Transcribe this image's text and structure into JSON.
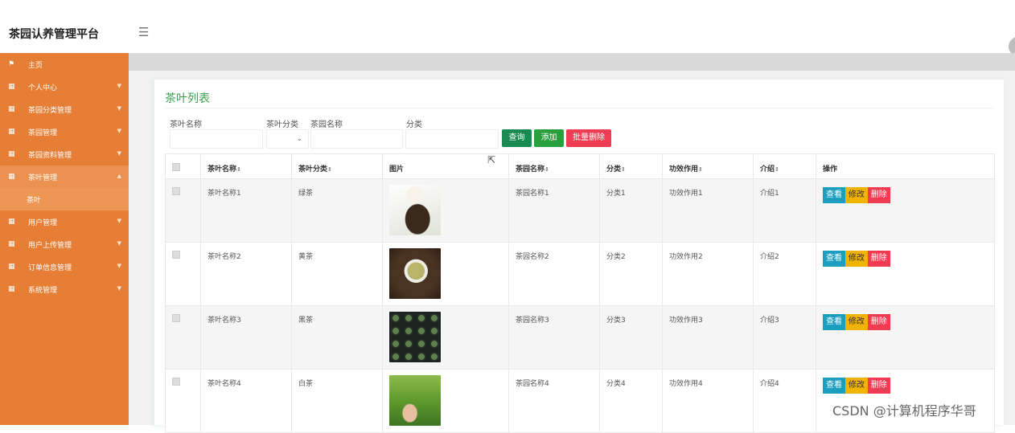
{
  "app": {
    "title": "茶园认养管理平台",
    "menu_icon": "hamburger-icon"
  },
  "sidebar": {
    "items": [
      {
        "label": "主页",
        "icon": "flag-icon",
        "expandable": false
      },
      {
        "label": "个人中心",
        "icon": "grid-icon",
        "expandable": true
      },
      {
        "label": "茶园分类管理",
        "icon": "grid-icon",
        "expandable": true
      },
      {
        "label": "茶园管理",
        "icon": "grid-icon",
        "expandable": true
      },
      {
        "label": "茶园资料管理",
        "icon": "grid-icon",
        "expandable": true
      },
      {
        "label": "茶叶管理",
        "icon": "grid-icon",
        "expandable": true,
        "active": true,
        "sub": [
          "茶叶"
        ]
      },
      {
        "label": "用户管理",
        "icon": "grid-icon",
        "expandable": true
      },
      {
        "label": "用户上传管理",
        "icon": "grid-icon",
        "expandable": true
      },
      {
        "label": "订单信息管理",
        "icon": "grid-icon",
        "expandable": true
      },
      {
        "label": "系统管理",
        "icon": "grid-icon",
        "expandable": true
      }
    ]
  },
  "panel": {
    "title": "茶叶列表"
  },
  "filters": {
    "tea_name_label": "茶叶名称",
    "tea_category_label": "茶叶分类",
    "garden_name_label": "茶园名称",
    "category_label": "分类",
    "query_button": "查询",
    "add_button": "添加",
    "batch_delete_button": "批量删除"
  },
  "table": {
    "headers": [
      "",
      "茶叶名称",
      "茶叶分类",
      "图片",
      "茶园名称",
      "分类",
      "功效作用",
      "介绍",
      "操作"
    ],
    "sortable": [
      false,
      true,
      true,
      false,
      true,
      true,
      true,
      true,
      false
    ],
    "rows": [
      {
        "name": "茶叶名称1",
        "category": "绿茶",
        "garden": "茶园名称1",
        "type": "分类1",
        "effect": "功效作用1",
        "intro": "介绍1"
      },
      {
        "name": "茶叶名称2",
        "category": "黄茶",
        "garden": "茶园名称2",
        "type": "分类2",
        "effect": "功效作用2",
        "intro": "介绍2"
      },
      {
        "name": "茶叶名称3",
        "category": "黑茶",
        "garden": "茶园名称3",
        "type": "分类3",
        "effect": "功效作用3",
        "intro": "介绍3"
      },
      {
        "name": "茶叶名称4",
        "category": "白茶",
        "garden": "茶园名称4",
        "type": "分类4",
        "effect": "功效作用4",
        "intro": "介绍4"
      }
    ],
    "actions": {
      "view": "查看",
      "edit": "修改",
      "delete": "删除"
    }
  },
  "watermark": "CSDN @计算机程序华哥",
  "colors": {
    "sidebar": "#e67f35",
    "title_green": "#3aa14e",
    "view_button": "#1b9ec0",
    "edit_button": "#f0b400",
    "delete_button": "#ef3c52",
    "query_button": "#1b8a52",
    "add_button": "#2aa03d"
  }
}
